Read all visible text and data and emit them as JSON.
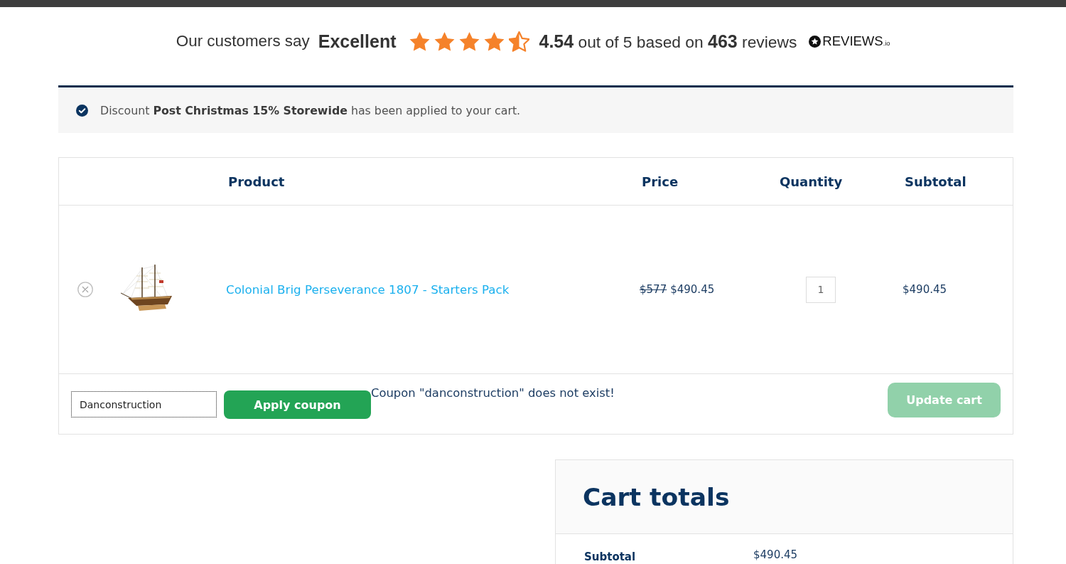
{
  "reviews": {
    "lead": "Our customers say",
    "rating_word": "Excellent",
    "stars": 4.5,
    "summary": "**4.54** out of 5 based on **463** reviews",
    "logo_text": "REVIEWS$_{.io}$"
  },
  "notice": {
    "message": "Discount **Post Christmas 15% Storewide** has been applied to your cart."
  },
  "cart_table": {
    "columns": [
      "Product",
      "Price",
      "Quantity",
      "Subtotal"
    ],
    "rows": [
      {
        "product": "Colonial Brig Perseverance 1807 - Starters Pack",
        "regular_price": "$577",
        "price": "$490.45",
        "quantity": "1",
        "subtotal": "$490.45"
      }
    ]
  },
  "coupon": {
    "value": "Danconstruction",
    "focused": true,
    "button": "Apply coupon",
    "error": "Coupon \"danconstruction\" does not exist!"
  },
  "update_button": {
    "label": "Update cart",
    "disabled": true
  },
  "cart_totals": {
    "title": "Cart totals",
    "rows": [
      {
        "label": "Subtotal",
        "value": "$490.45"
      }
    ]
  }
}
